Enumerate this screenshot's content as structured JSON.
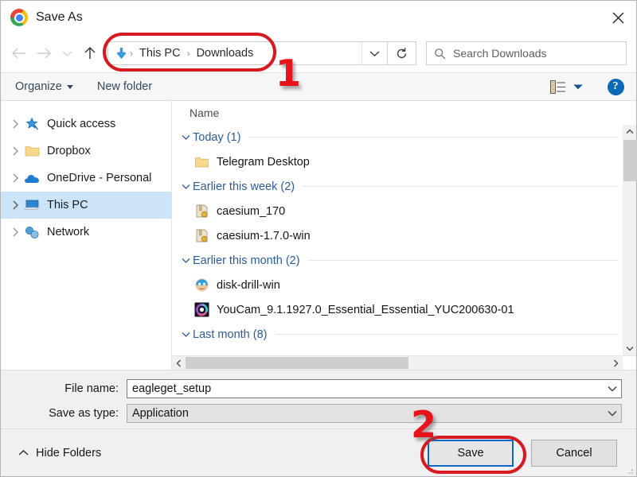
{
  "window": {
    "title": "Save As",
    "app_icon": "chrome-logo-icon",
    "close_label": "✕"
  },
  "nav": {
    "back_icon": "arrow-left-icon",
    "forward_icon": "arrow-right-icon",
    "recent_icon": "chevron-down-icon",
    "up_icon": "arrow-up-icon",
    "breadcrumb_icon": "downloads-arrow-icon",
    "breadcrumb": [
      "This PC",
      "Downloads"
    ],
    "breadcrumb_separator": "›",
    "dropdown_icon": "chevron-down-icon",
    "refresh_icon": "refresh-icon",
    "refresh_glyph": "↻"
  },
  "search": {
    "icon": "search-icon",
    "placeholder": "Search Downloads",
    "value": ""
  },
  "commandbar": {
    "organize_label": "Organize",
    "new_folder_label": "New folder",
    "view_icon": "view-details-icon",
    "view_caret_icon": "chevron-down-icon",
    "help_icon": "help-icon",
    "help_glyph": "?"
  },
  "sidebar": {
    "items": [
      {
        "label": "Quick access",
        "icon": "star-pin-icon",
        "selected": false
      },
      {
        "label": "Dropbox",
        "icon": "folder-icon",
        "selected": false
      },
      {
        "label": "OneDrive - Personal",
        "icon": "cloud-icon",
        "selected": false
      },
      {
        "label": "This PC",
        "icon": "computer-icon",
        "selected": true
      },
      {
        "label": "Network",
        "icon": "network-icon",
        "selected": false
      }
    ],
    "expand_icon": "chevron-right-icon"
  },
  "filelist": {
    "column_header": "Name",
    "collapse_icon": "chevron-down-icon",
    "groups": [
      {
        "label": "Today (1)",
        "items": [
          {
            "name": "Telegram Desktop",
            "icon": "folder-icon"
          }
        ]
      },
      {
        "label": "Earlier this week (2)",
        "items": [
          {
            "name": "caesium_170",
            "icon": "archive-zip-icon"
          },
          {
            "name": "caesium-1.7.0-win",
            "icon": "archive-zip-icon"
          }
        ]
      },
      {
        "label": "Earlier this month (2)",
        "items": [
          {
            "name": "disk-drill-win",
            "icon": "disk-drill-app-icon"
          },
          {
            "name": "YouCam_9.1.1927.0_Essential_Essential_YUC200630-01",
            "icon": "youcam-app-icon"
          }
        ]
      },
      {
        "label": "Last month (8)",
        "items": []
      }
    ],
    "vscroll_up_icon": "chevron-up-icon",
    "vscroll_down_icon": "chevron-down-icon",
    "hscroll_left_icon": "chevron-left-icon",
    "hscroll_right_icon": "chevron-right-icon"
  },
  "form": {
    "filename_label": "File name:",
    "filename_value": "eagleget_setup",
    "filetype_label": "Save as type:",
    "filetype_value": "Application",
    "dropdown_icon": "chevron-down-icon"
  },
  "footer": {
    "hide_folders_label": "Hide Folders",
    "hide_folders_icon": "chevron-up-icon",
    "save_label": "Save",
    "cancel_label": "Cancel"
  },
  "annotations": [
    {
      "number": "1",
      "target": "breadcrumb-bar"
    },
    {
      "number": "2",
      "target": "save-button"
    }
  ],
  "colors": {
    "annotation_red": "#d71920",
    "annotation_number_red": "#e8131a",
    "selection_blue": "#cce4f7",
    "group_header_blue": "#2b5b9e",
    "primary_button_border": "#0b68c8",
    "help_blue": "#0a6ab4"
  }
}
